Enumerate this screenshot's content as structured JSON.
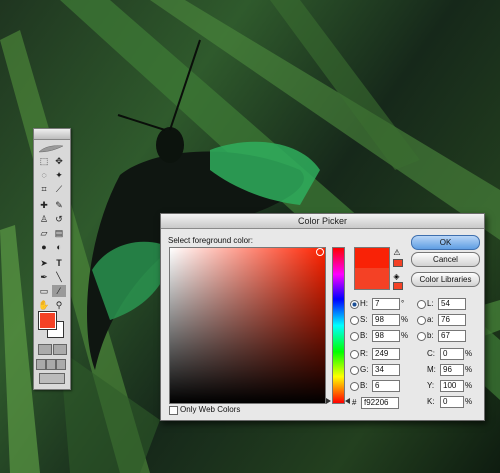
{
  "dialog": {
    "title": "Color Picker",
    "prompt": "Select foreground color:",
    "buttons": {
      "ok": "OK",
      "cancel": "Cancel",
      "libraries": "Color Libraries"
    },
    "only_web_colors": "Only Web Colors",
    "only_web_colors_checked": false,
    "hsb": [
      {
        "label": "H:",
        "value": "7",
        "unit": "°",
        "selected": true
      },
      {
        "label": "S:",
        "value": "98",
        "unit": "%",
        "selected": false
      },
      {
        "label": "B:",
        "value": "98",
        "unit": "%",
        "selected": false
      }
    ],
    "rgb": [
      {
        "label": "R:",
        "value": "249"
      },
      {
        "label": "G:",
        "value": "34"
      },
      {
        "label": "B:",
        "value": "6"
      }
    ],
    "lab": [
      {
        "label": "L:",
        "value": "54"
      },
      {
        "label": "a:",
        "value": "76"
      },
      {
        "label": "b:",
        "value": "67"
      }
    ],
    "cmyk": [
      {
        "label": "C:",
        "value": "0",
        "unit": "%"
      },
      {
        "label": "M:",
        "value": "96",
        "unit": "%"
      },
      {
        "label": "Y:",
        "value": "100",
        "unit": "%"
      },
      {
        "label": "K:",
        "value": "0",
        "unit": "%"
      }
    ],
    "hex_label": "#",
    "hex": "f92206",
    "new_color": "#f92206",
    "current_color": "#f44125"
  },
  "tools": {
    "foreground_color": "#f44125",
    "background_color": "#ffffff",
    "icons": [
      "marquee-icon",
      "move-icon",
      "lasso-icon",
      "magic-wand-icon",
      "crop-icon",
      "slice-icon",
      "healing-brush-icon",
      "brush-icon",
      "clone-stamp-icon",
      "history-brush-icon",
      "eraser-icon",
      "gradient-icon",
      "blur-icon",
      "dodge-icon",
      "path-select-icon",
      "type-icon",
      "pen-icon",
      "shape-icon",
      "notes-icon",
      "eyedropper-icon",
      "hand-icon",
      "zoom-icon"
    ]
  }
}
